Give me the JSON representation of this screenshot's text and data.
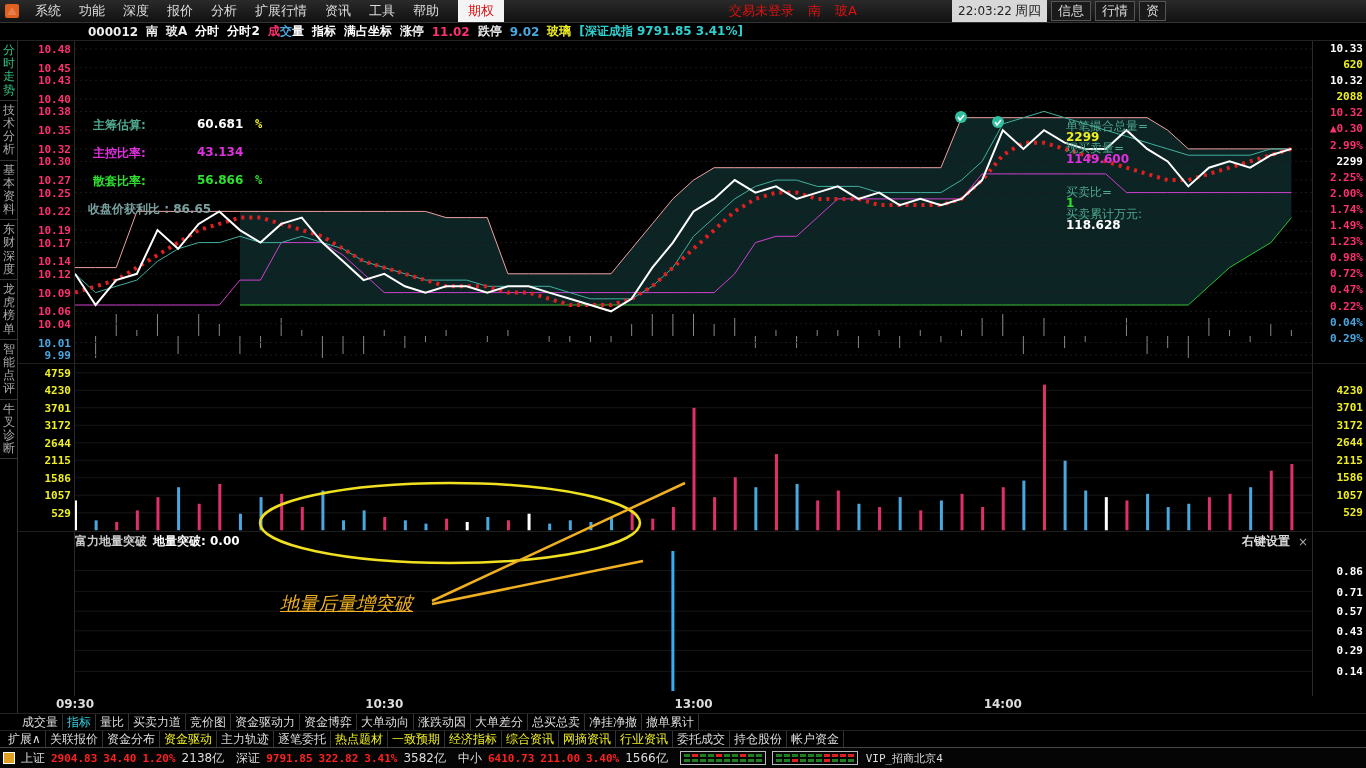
{
  "menu": {
    "items": [
      {
        "label": "系统",
        "selected": false
      },
      {
        "label": "功能",
        "selected": false
      },
      {
        "label": "深度",
        "selected": false
      },
      {
        "label": "报价",
        "selected": false
      },
      {
        "label": "分析",
        "selected": false
      },
      {
        "label": "扩展行情",
        "selected": false
      },
      {
        "label": "资讯",
        "selected": false
      },
      {
        "label": "工具",
        "selected": false
      },
      {
        "label": "帮助",
        "selected": false
      },
      {
        "label": "期权",
        "selected": true
      }
    ],
    "trade_status": [
      "交易未登录",
      "南",
      "玻A"
    ],
    "clock": "22:03:22",
    "weekday": "周四",
    "buttons": [
      "信息",
      "行情",
      "资"
    ]
  },
  "info_bar": {
    "code": "000012",
    "name": [
      "南",
      "玻A"
    ],
    "buttons": [
      {
        "label": "分时",
        "kind": "plain"
      },
      {
        "label": "分时2",
        "kind": "plain"
      },
      {
        "label": "成交量",
        "kind": "tricolor"
      },
      {
        "label": "指标",
        "kind": "plain"
      },
      {
        "label": "满占坐标",
        "kind": "plain"
      }
    ],
    "limit_up": {
      "label": "涨停",
      "value": "11.02"
    },
    "limit_down": {
      "label": "跌停",
      "value": "9.02"
    },
    "sector": "玻璃",
    "index_quote": "[深证成指 9791.85 3.41%]"
  },
  "side_tabs": [
    {
      "label": "分时走势",
      "selected": true
    },
    {
      "label": "技术分析",
      "selected": false
    },
    {
      "label": "基本资料",
      "selected": false
    },
    {
      "label": "东财深度",
      "selected": false
    },
    {
      "label": "龙虎榜单",
      "selected": false
    },
    {
      "label": "智能点评",
      "selected": false
    },
    {
      "label": "牛叉诊断",
      "selected": false
    }
  ],
  "price_panel": {
    "right_axis": [
      {
        "text": "10.33",
        "kind": "neutral"
      },
      {
        "text": "620",
        "kind": "volume"
      },
      {
        "text": "10.32",
        "kind": "neutral"
      },
      {
        "text": "2088",
        "kind": "volume"
      },
      {
        "text": "10.32",
        "kind": "up"
      },
      {
        "text": "▲0.30",
        "kind": "up"
      },
      {
        "text": "2.99%",
        "kind": "up"
      },
      {
        "text": "2299",
        "kind": "neutral"
      },
      {
        "text": "2.25%",
        "kind": "up"
      },
      {
        "text": "2.00%",
        "kind": "up"
      },
      {
        "text": "1.74%",
        "kind": "up"
      },
      {
        "text": "1.49%",
        "kind": "up"
      },
      {
        "text": "1.23%",
        "kind": "up"
      },
      {
        "text": "0.98%",
        "kind": "up"
      },
      {
        "text": "0.72%",
        "kind": "up"
      },
      {
        "text": "0.47%",
        "kind": "up"
      },
      {
        "text": "0.22%",
        "kind": "up"
      },
      {
        "text": "0.04%",
        "kind": "down"
      },
      {
        "text": "0.29%",
        "kind": "down"
      }
    ],
    "chip_readouts": [
      {
        "label": "主筹估算:",
        "value": "60.681",
        "unit": "%",
        "kind": "chip"
      },
      {
        "label": "主控比率:",
        "value": "43.134",
        "kind": "control"
      },
      {
        "label": "散套比率:",
        "value": "56.866",
        "unit": "%",
        "kind": "loose"
      }
    ],
    "profit_ratio": "收盘价获利比 : 86.65",
    "trade_readouts": [
      {
        "label": "单笔撮合总量=",
        "value": "2299",
        "color": "#f0f020"
      },
      {
        "label": "现买卖量=",
        "value": "1149.600",
        "color": "#e030e0"
      },
      {
        "label": "买卖比=",
        "value": "1",
        "color": "#30e030"
      },
      {
        "label": "买卖累计万元:",
        "value": "118.628",
        "color": "#ffffff"
      }
    ],
    "chart_data": {
      "type": "line",
      "ylim": [
        9.99,
        10.48
      ],
      "grid": true,
      "categories": [
        null,
        null,
        null,
        null,
        null,
        null,
        null,
        null,
        null,
        null,
        null,
        null,
        null,
        null,
        null,
        null,
        null,
        null,
        null,
        null,
        null,
        null,
        null,
        null,
        null,
        null,
        null,
        null,
        null,
        null,
        null,
        null,
        null,
        null,
        null,
        null,
        null,
        null,
        null,
        null,
        null,
        null,
        null,
        null,
        null,
        null,
        null,
        null,
        null,
        null,
        null,
        null,
        null,
        null,
        null,
        null,
        null,
        null,
        null,
        null
      ],
      "yticks": [
        10.48,
        10.45,
        10.43,
        {
          "value": 10.4,
          "label": "10.40"
        },
        10.38,
        10.35,
        10.32,
        {
          "value": 10.3,
          "label": "10.30"
        },
        10.27,
        10.25,
        10.22,
        10.19,
        10.17,
        10.14,
        10.12,
        10.09,
        10.06,
        10.04,
        10.01,
        9.99
      ],
      "series": [
        {
          "color": "#ffffff",
          "values": [
            10.12,
            10.07,
            10.11,
            10.12,
            10.19,
            10.16,
            10.2,
            10.22,
            10.19,
            10.17,
            10.2,
            10.21,
            10.17,
            10.14,
            10.11,
            10.12,
            10.1,
            10.09,
            10.1,
            10.1,
            10.09,
            10.1,
            10.1,
            10.09,
            10.08,
            10.07,
            10.06,
            10.08,
            10.13,
            10.17,
            10.22,
            10.24,
            10.27,
            10.25,
            10.26,
            10.24,
            10.25,
            10.26,
            10.24,
            10.25,
            10.23,
            10.24,
            10.23,
            10.24,
            10.27,
            10.35,
            10.32,
            10.35,
            10.33,
            10.32,
            10.32,
            10.35,
            10.32,
            10.3,
            10.26,
            10.29,
            10.3,
            10.29,
            10.31,
            10.32
          ]
        },
        {
          "color": "#40b0a0",
          "values": [
            10.12,
            10.09,
            10.1,
            10.11,
            10.14,
            10.16,
            10.17,
            10.17,
            10.18,
            10.17,
            10.17,
            10.18,
            10.17,
            10.16,
            10.14,
            10.13,
            10.12,
            10.11,
            10.11,
            10.11,
            10.1,
            10.1,
            10.1,
            10.1,
            10.09,
            10.08,
            10.08,
            10.08,
            10.1,
            10.13,
            10.18,
            10.21,
            10.24,
            10.26,
            10.27,
            10.27,
            10.26,
            10.26,
            10.26,
            10.25,
            10.25,
            10.25,
            10.25,
            10.27,
            10.3,
            10.36,
            10.37,
            10.38,
            10.37,
            10.36,
            10.35,
            10.34,
            10.33,
            10.32,
            10.31,
            10.31,
            10.31,
            10.31,
            10.32,
            10.32
          ]
        },
        {
          "color": "#e02020",
          "line_style": "dotted",
          "values": [
            10.09,
            10.1,
            10.11,
            10.13,
            10.15,
            10.17,
            10.19,
            10.2,
            10.21,
            10.21,
            10.2,
            10.19,
            10.18,
            10.16,
            10.14,
            10.13,
            10.12,
            10.11,
            10.1,
            10.1,
            10.1,
            10.09,
            10.09,
            10.08,
            10.07,
            10.07,
            10.07,
            10.08,
            10.1,
            10.13,
            10.16,
            10.19,
            10.22,
            10.24,
            10.25,
            10.25,
            10.24,
            10.24,
            10.24,
            10.23,
            10.23,
            10.23,
            10.23,
            10.24,
            10.27,
            10.31,
            10.33,
            10.33,
            10.32,
            10.31,
            10.3,
            10.29,
            10.28,
            10.27,
            10.27,
            10.28,
            10.29,
            10.3,
            10.31,
            10.32
          ]
        },
        {
          "color": "#f0a0a0",
          "values": [
            10.13,
            10.13,
            10.13,
            10.22,
            10.22,
            10.22,
            10.22,
            10.22,
            10.22,
            10.22,
            10.22,
            10.22,
            10.22,
            10.22,
            10.22,
            10.22,
            10.22,
            10.22,
            10.21,
            10.21,
            10.21,
            10.12,
            10.12,
            10.12,
            10.12,
            10.12,
            10.12,
            10.16,
            10.2,
            10.24,
            10.27,
            10.29,
            10.29,
            10.29,
            10.29,
            10.29,
            10.29,
            10.29,
            10.29,
            10.29,
            10.29,
            10.29,
            10.29,
            10.37,
            10.37,
            10.37,
            10.37,
            10.37,
            10.37,
            10.37,
            10.37,
            10.37,
            10.37,
            10.35,
            10.32,
            10.32,
            10.32,
            10.32,
            10.32,
            10.32
          ]
        },
        {
          "color": "#d040d0",
          "values": [
            10.07,
            10.07,
            10.07,
            10.07,
            10.07,
            10.07,
            10.07,
            10.07,
            10.11,
            10.11,
            10.17,
            10.17,
            10.17,
            10.15,
            10.12,
            10.09,
            10.09,
            10.09,
            10.09,
            10.09,
            10.09,
            10.09,
            10.09,
            10.09,
            10.09,
            10.09,
            10.09,
            10.09,
            10.09,
            10.09,
            10.09,
            10.09,
            10.12,
            10.17,
            10.18,
            10.18,
            10.21,
            10.24,
            10.24,
            10.24,
            10.24,
            10.24,
            10.24,
            10.24,
            10.28,
            10.28,
            10.28,
            10.28,
            10.28,
            10.28,
            10.28,
            10.25,
            10.25,
            10.25,
            10.25,
            10.25,
            10.25,
            10.25,
            10.25,
            10.25
          ]
        },
        {
          "color": "#30c030",
          "values": [
            null,
            null,
            null,
            null,
            null,
            null,
            null,
            null,
            10.07,
            10.07,
            10.07,
            10.07,
            10.07,
            10.07,
            10.07,
            10.07,
            10.07,
            10.07,
            10.07,
            10.07,
            10.07,
            10.07,
            10.07,
            10.07,
            10.07,
            10.07,
            10.07,
            10.07,
            10.07,
            10.07,
            10.07,
            10.07,
            10.07,
            10.07,
            10.07,
            10.07,
            10.07,
            10.07,
            10.07,
            10.07,
            10.07,
            10.07,
            10.07,
            10.07,
            10.07,
            10.07,
            10.07,
            10.07,
            10.07,
            10.07,
            10.07,
            10.07,
            10.07,
            10.07,
            10.07,
            10.1,
            10.13,
            10.15,
            10.17,
            10.21
          ]
        }
      ]
    }
  },
  "volume_panel": {
    "right_axis": [
      "4230",
      "3701",
      "3172",
      "2644",
      "2115",
      "1586",
      "1057",
      "529"
    ],
    "chart_data": {
      "type": "bar",
      "ylim": [
        0,
        4759
      ],
      "grid": true,
      "stacked": true,
      "categories": [
        null,
        null,
        null,
        null,
        null,
        null,
        null,
        null,
        null,
        null,
        null,
        null,
        null,
        null,
        null,
        null,
        null,
        null,
        null,
        null,
        null,
        null,
        null,
        null,
        null,
        null,
        null,
        null,
        null,
        null,
        null,
        null,
        null,
        null,
        null,
        null,
        null,
        null,
        null,
        null,
        null,
        null,
        null,
        null,
        null,
        null,
        null,
        null,
        null,
        null,
        null,
        null,
        null,
        null,
        null,
        null,
        null,
        null,
        null,
        null
      ],
      "yticks": [
        4759,
        4230,
        3701,
        3172,
        2644,
        2115,
        1586,
        1057,
        529
      ],
      "series": [
        {
          "color": "#e0306a",
          "values": [
            0,
            0,
            250,
            600,
            1000,
            0,
            800,
            1400,
            0,
            0,
            1100,
            700,
            0,
            0,
            0,
            400,
            0,
            0,
            350,
            0,
            0,
            300,
            0,
            0,
            0,
            0,
            0,
            600,
            350,
            700,
            3700,
            1000,
            1600,
            0,
            2300,
            0,
            900,
            1200,
            0,
            700,
            0,
            600,
            0,
            1100,
            700,
            1300,
            0,
            4400,
            0,
            0,
            0,
            900,
            0,
            0,
            0,
            1000,
            1100,
            0,
            1800,
            2000
          ]
        },
        {
          "color": "#4aa8e0",
          "values": [
            0,
            300,
            0,
            0,
            0,
            1300,
            0,
            0,
            500,
            1000,
            0,
            0,
            1200,
            300,
            600,
            0,
            300,
            200,
            0,
            0,
            400,
            0,
            0,
            200,
            300,
            250,
            400,
            0,
            0,
            0,
            0,
            0,
            0,
            1300,
            0,
            1400,
            0,
            0,
            800,
            0,
            1000,
            0,
            900,
            0,
            0,
            0,
            1500,
            0,
            2100,
            1200,
            0,
            0,
            1100,
            700,
            800,
            0,
            0,
            1300,
            0,
            0
          ]
        },
        {
          "color": "#ffffff",
          "values": [
            900,
            0,
            0,
            0,
            0,
            0,
            0,
            0,
            0,
            0,
            0,
            0,
            0,
            0,
            0,
            0,
            0,
            0,
            0,
            250,
            0,
            0,
            500,
            0,
            0,
            0,
            0,
            0,
            0,
            0,
            0,
            0,
            0,
            0,
            0,
            0,
            0,
            0,
            0,
            0,
            0,
            0,
            0,
            0,
            0,
            0,
            0,
            0,
            0,
            0,
            1000,
            0,
            0,
            0,
            0,
            0,
            0,
            0,
            0,
            0
          ]
        }
      ]
    }
  },
  "signal_panel": {
    "title": "富力地量突破",
    "reading": "地量突破: 0.00",
    "settings": "右键设置",
    "close": "×",
    "chart_data": {
      "type": "bar",
      "ylim": [
        0,
        1
      ],
      "grid": true,
      "categories": [
        "09:30",
        null,
        null,
        null,
        null,
        null,
        null,
        null,
        null,
        null,
        null,
        null,
        null,
        null,
        null,
        "10:30",
        null,
        null,
        null,
        null,
        null,
        null,
        null,
        null,
        null,
        null,
        null,
        null,
        null,
        null,
        "13:00",
        null,
        null,
        null,
        null,
        null,
        null,
        null,
        null,
        null,
        null,
        null,
        null,
        null,
        null,
        "14:00",
        null,
        null,
        null,
        null,
        null,
        null,
        null,
        null,
        null,
        null,
        null,
        null,
        null,
        null
      ],
      "yticks": [
        0.86,
        0.71,
        0.57,
        0.43,
        0.29,
        0.14
      ],
      "series": [
        {
          "color": "#30b0f0",
          "values": [
            0,
            0,
            0,
            0,
            0,
            0,
            0,
            0,
            0,
            0,
            0,
            0,
            0,
            0,
            0,
            0,
            0,
            0,
            0,
            0,
            0,
            0,
            0,
            0,
            0,
            0,
            0,
            0,
            0,
            1,
            0,
            0,
            0,
            0,
            0,
            0,
            0,
            0,
            0,
            0,
            0,
            0,
            0,
            0,
            0,
            0,
            0,
            0,
            0,
            0,
            0,
            0,
            0,
            0,
            0,
            0,
            0,
            0,
            0,
            0
          ]
        }
      ]
    }
  },
  "annotation": {
    "text": "地量后量增突破"
  },
  "tab_rows": [
    [
      {
        "label": "成交量",
        "selected": false
      },
      {
        "label": "指标",
        "selected": true
      },
      {
        "label": "量比",
        "selected": false
      },
      {
        "label": "买卖力道",
        "selected": false
      },
      {
        "label": "竞价图",
        "selected": false
      },
      {
        "label": "资金驱动力",
        "selected": false
      },
      {
        "label": "资金博弈",
        "selected": false
      },
      {
        "label": "大单动向",
        "selected": false
      },
      {
        "label": "涨跌动因",
        "selected": false
      },
      {
        "label": "大单差分",
        "selected": false
      },
      {
        "label": "总买总卖",
        "selected": false
      },
      {
        "label": "净挂净撤",
        "selected": false
      },
      {
        "label": "撤单累计",
        "selected": false
      }
    ],
    [
      {
        "label": "扩展∧",
        "selected": false
      },
      {
        "label": "关联报价",
        "selected": false
      },
      {
        "label": "资金分布",
        "selected": false
      },
      {
        "label": "资金驱动",
        "selected": true
      },
      {
        "label": "主力轨迹",
        "selected": false
      },
      {
        "label": "逐笔委托",
        "selected": false
      },
      {
        "label": "热点题材",
        "selected": true
      },
      {
        "label": "一致预期",
        "selected": true
      },
      {
        "label": "经济指标",
        "selected": true
      },
      {
        "label": "综合资讯",
        "selected": true
      },
      {
        "label": "网摘资讯",
        "selected": true
      },
      {
        "label": "行业资讯",
        "selected": true
      },
      {
        "label": "委托成交",
        "selected": false
      },
      {
        "label": "持仓股份",
        "selected": false
      },
      {
        "label": "帐户资金",
        "selected": false
      }
    ]
  ],
  "status_bar": {
    "indices": [
      {
        "name": "上证",
        "value": "2904.83",
        "change": "34.40",
        "percent": "1.20%",
        "amount": "2138亿"
      },
      {
        "name": "深证",
        "value": "9791.85",
        "change": "322.82",
        "percent": "3.41%",
        "amount": "3582亿"
      },
      {
        "name": "中小",
        "value": "6410.73",
        "change": "211.00",
        "percent": "3.40%",
        "amount": "1566亿"
      }
    ],
    "account": "VIP_招商北京4"
  }
}
